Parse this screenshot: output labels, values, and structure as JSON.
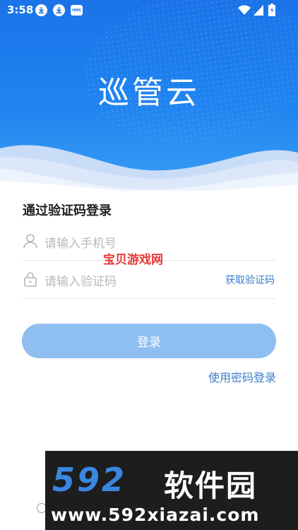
{
  "status_bar": {
    "time": "3:58",
    "icons": [
      "download-icon",
      "download-icon",
      "hms-icon",
      "wifi-icon",
      "signal-icon",
      "battery-icon"
    ],
    "hms_label": "HMS"
  },
  "header": {
    "app_title": "巡管云"
  },
  "login": {
    "section_title": "通过验证码登录",
    "phone_placeholder": "请输入手机号",
    "code_placeholder": "请输入验证码",
    "get_code_label": "获取验证码",
    "login_button": "登录",
    "password_login_link": "使用密码登录"
  },
  "overlay": {
    "watermark_text": "宝贝游戏网"
  },
  "promo": {
    "logo_number": "592",
    "logo_text": "软件园",
    "url": "www.592xiazai.com"
  },
  "colors": {
    "header_blue": "#1a73e8",
    "link_blue": "#3e7dc8",
    "button_blue": "#8fbff0",
    "watermark_red": "#e53935"
  }
}
